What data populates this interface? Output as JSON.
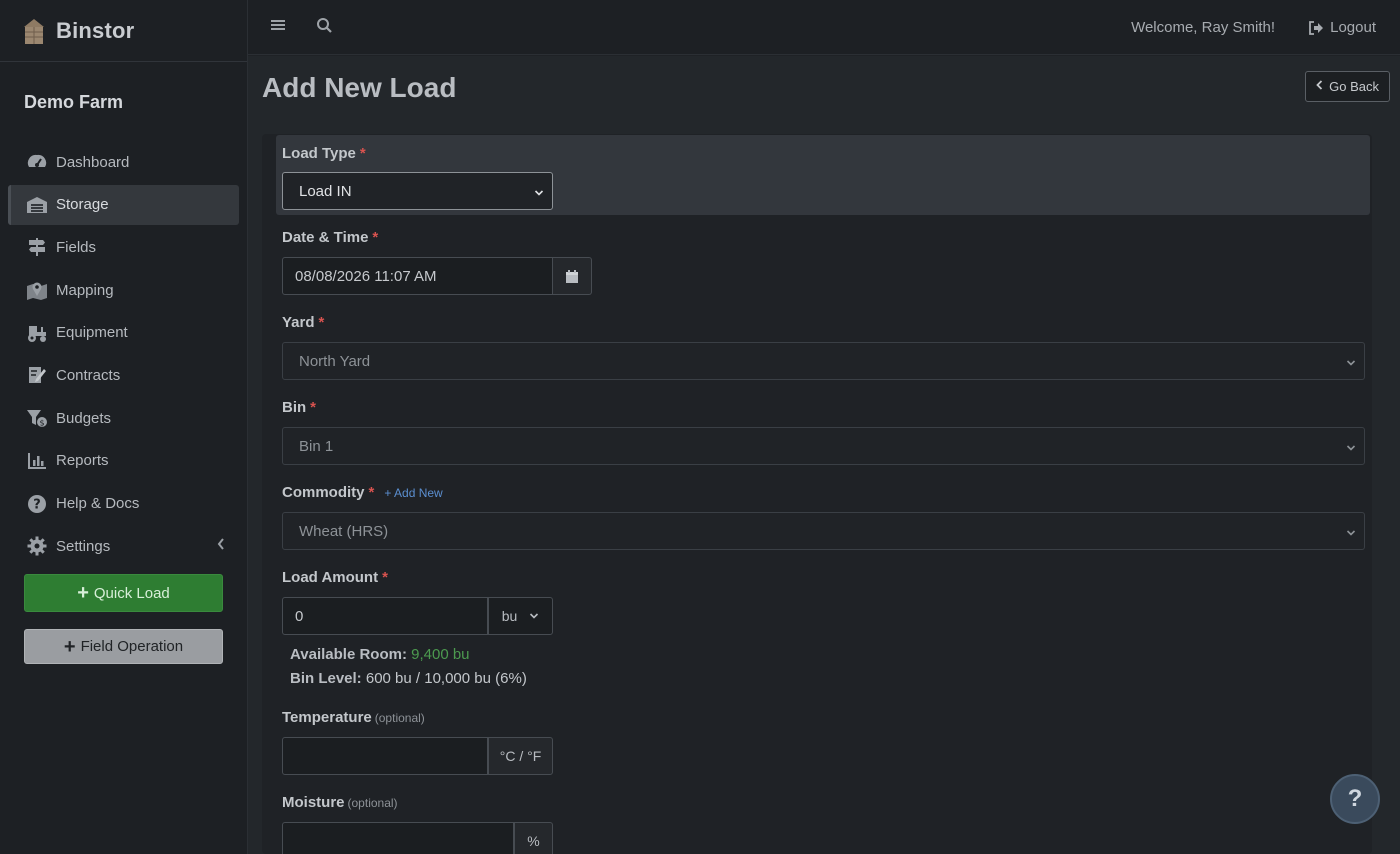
{
  "brand": {
    "name": "Binstor"
  },
  "farm": {
    "name": "Demo Farm"
  },
  "nav": [
    {
      "label": "Dashboard",
      "icon": "dashboard-icon"
    },
    {
      "label": "Storage",
      "icon": "warehouse-icon",
      "active": true
    },
    {
      "label": "Fields",
      "icon": "signpost-icon"
    },
    {
      "label": "Mapping",
      "icon": "map-pin-icon"
    },
    {
      "label": "Equipment",
      "icon": "tractor-icon"
    },
    {
      "label": "Contracts",
      "icon": "contract-icon"
    },
    {
      "label": "Budgets",
      "icon": "budget-icon"
    },
    {
      "label": "Reports",
      "icon": "chart-icon"
    },
    {
      "label": "Help & Docs",
      "icon": "question-icon"
    },
    {
      "label": "Settings",
      "icon": "gear-icon"
    }
  ],
  "actions": {
    "quick_load": "Quick Load",
    "field_operation": "Field Operation"
  },
  "topbar": {
    "welcome": "Welcome, Ray Smith!",
    "logout": "Logout"
  },
  "page": {
    "title": "Add New Load",
    "go_back": "Go Back"
  },
  "form": {
    "load_type": {
      "label": "Load Type",
      "value": "Load IN"
    },
    "datetime": {
      "label": "Date & Time",
      "value": "08/08/2026 11:07 AM"
    },
    "yard": {
      "label": "Yard",
      "value": "North Yard"
    },
    "bin": {
      "label": "Bin",
      "value": "Bin 1"
    },
    "commodity": {
      "label": "Commodity",
      "add_new": "+ Add New",
      "value": "Wheat (HRS)"
    },
    "load_amount": {
      "label": "Load Amount",
      "value": "0",
      "unit": "bu"
    },
    "available_room": {
      "label": "Available Room:",
      "value": "9,400 bu"
    },
    "bin_level": {
      "label": "Bin Level:",
      "value": "600 bu / 10,000 bu (6%)"
    },
    "temperature": {
      "label": "Temperature",
      "optional": "(optional)",
      "value": "",
      "unit": "°C / °F"
    },
    "moisture": {
      "label": "Moisture",
      "optional": "(optional)",
      "value": "",
      "unit": "%"
    }
  },
  "help_button": "?",
  "colors": {
    "accent_green": "#2e7d32",
    "required_red": "#d9534f",
    "link_blue": "#5b8fd0"
  }
}
